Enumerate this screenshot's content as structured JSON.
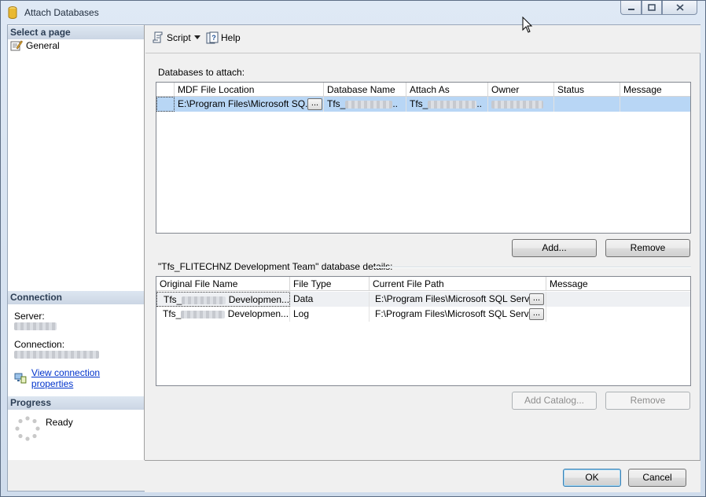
{
  "window": {
    "title": "Attach Databases"
  },
  "left_panel": {
    "select_page_header": "Select a page",
    "pages": [
      {
        "label": "General"
      }
    ],
    "connection_header": "Connection",
    "server_label": "Server:",
    "connection_label": "Connection:",
    "view_connection_link": "View connection properties",
    "progress_header": "Progress",
    "progress_status": "Ready"
  },
  "toolbar": {
    "script_label": "Script",
    "help_label": "Help"
  },
  "databases_section": {
    "label": "Databases to attach:",
    "columns": [
      "MDF File Location",
      "Database Name",
      "Attach As",
      "Owner",
      "Status",
      "Message"
    ],
    "rows": [
      {
        "mdf_location": "E:\\Program Files\\Microsoft SQ...",
        "database_name": "Tfs_",
        "attach_as": "Tfs_",
        "owner": "",
        "status": "",
        "message": ""
      }
    ],
    "add_button": "Add...",
    "remove_button": "Remove"
  },
  "details_section": {
    "label": "\"Tfs_FLITECHNZ Development Team\" database details:",
    "columns": [
      "Original File Name",
      "File Type",
      "Current File Path",
      "Message"
    ],
    "rows": [
      {
        "name_prefix": "Tfs_",
        "name_suffix": "Developmen...",
        "file_type": "Data",
        "path": "E:\\Program Files\\Microsoft SQL Serv...",
        "message": ""
      },
      {
        "name_prefix": "Tfs_",
        "name_suffix": "Developmen...",
        "file_type": "Log",
        "path": "F:\\Program Files\\Microsoft SQL Serv...",
        "message": ""
      }
    ],
    "add_catalog_button": "Add Catalog...",
    "remove_button": "Remove"
  },
  "dialog_buttons": {
    "ok": "OK",
    "cancel": "Cancel"
  },
  "colors": {
    "selected_row": "#b8d6f5",
    "link": "#0033cc",
    "section_header": "#cbd6e4"
  }
}
